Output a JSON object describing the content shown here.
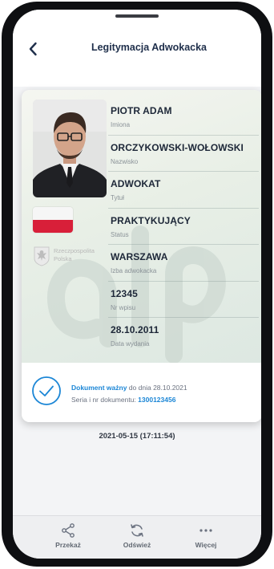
{
  "header": {
    "title": "Legitymacja Adwokacka"
  },
  "card": {
    "emblem_text": [
      "Rzeczpospolita",
      "Polska"
    ],
    "fields": [
      {
        "value": "PIOTR ADAM",
        "label": "Imiona"
      },
      {
        "value": "ORCZYKOWSKI-WOŁOWSKI",
        "label": "Nazwisko"
      },
      {
        "value": "ADWOKAT",
        "label": "Tytuł"
      },
      {
        "value": "PRAKTYKUJĄCY",
        "label": "Status"
      },
      {
        "value": "WARSZAWA",
        "label": "Izba adwokacka"
      },
      {
        "value": "12345",
        "label": "Nr wpisu"
      },
      {
        "value": "28.10.2011",
        "label": "Data wydania"
      }
    ],
    "validity": {
      "status": "Dokument ważny",
      "until_prefix": " do dnia ",
      "until_date": "28.10.2021",
      "serial_prefix": "Seria i nr dokumentu: ",
      "serial_number": "1300123456"
    }
  },
  "timestamp": "2021-05-15 (17:11:54)",
  "bottom_nav": {
    "items": [
      {
        "label": "Przekaż",
        "icon": "share-icon"
      },
      {
        "label": "Odśwież",
        "icon": "refresh-icon"
      },
      {
        "label": "Więcej",
        "icon": "more-icon"
      }
    ]
  },
  "colors": {
    "accent": "#1b86d6",
    "title_text": "#1f2f4b",
    "flag_white": "#f6f6f6",
    "flag_red": "#d81f39"
  }
}
